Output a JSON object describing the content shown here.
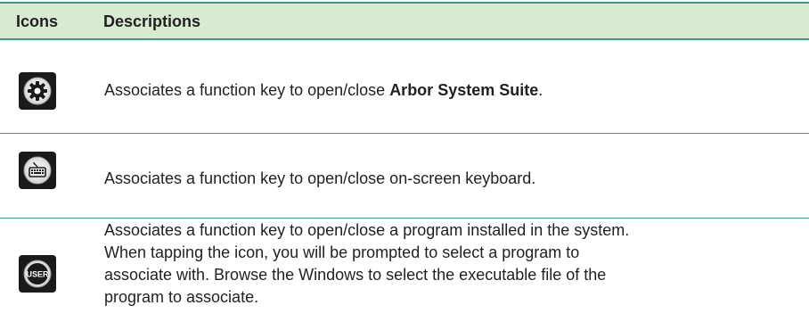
{
  "header": {
    "col_icons": "Icons",
    "col_descriptions": "Descriptions"
  },
  "rows": [
    {
      "icon": "gear-icon",
      "text_before": "Associates a function key to open/close ",
      "text_bold": "Arbor System Suite",
      "text_after": "."
    },
    {
      "icon": "keyboard-icon",
      "text": "Associates a function key to open/close on-screen keyboard."
    },
    {
      "icon": "user-icon",
      "icon_label": "USER",
      "lines": [
        "Associates a function key to open/close a program installed in the system.",
        "When tapping the icon, you will be prompted to select a program to",
        "associate with. Browse the Windows to select the executable file of the",
        "program to associate."
      ]
    }
  ]
}
